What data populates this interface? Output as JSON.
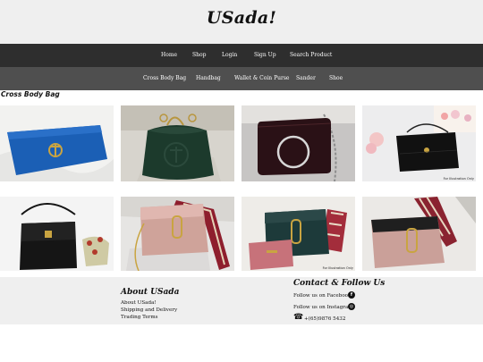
{
  "site": {
    "logo": "USada!"
  },
  "nav_main": [
    "Home",
    "Shop",
    "Login",
    "Sign Up",
    "Search Product"
  ],
  "nav_categories": [
    "Cross Body Bag",
    "Handbag",
    "Wallet & Coin Purse",
    "Sander",
    "Shoe"
  ],
  "section": {
    "title": "Cross Body Bag"
  },
  "products": [
    {
      "badge": ""
    },
    {
      "badge": ""
    },
    {
      "badge": ""
    },
    {
      "badge": "For Illustration Only"
    },
    {
      "badge": ""
    },
    {
      "badge": ""
    },
    {
      "badge": "For Illustration Only"
    },
    {
      "badge": ""
    }
  ],
  "footer": {
    "about": {
      "title": "About USada",
      "links": [
        "About USada!",
        "Shipping and Delivery",
        "Trading Terms"
      ]
    },
    "contact": {
      "title": "Contact & Follow Us",
      "facebook": "Follow us on Facebook",
      "instagram": "Follow us on Instagram",
      "phone": "+(65)9876 5432"
    }
  },
  "icons": {
    "facebook": "facebook-icon",
    "instagram": "instagram-icon",
    "phone": "phone-icon"
  },
  "colors": {
    "header_bg": "#efefef",
    "nav_primary_bg": "#2e2e2e",
    "nav_secondary_bg": "#4f4f4f"
  }
}
